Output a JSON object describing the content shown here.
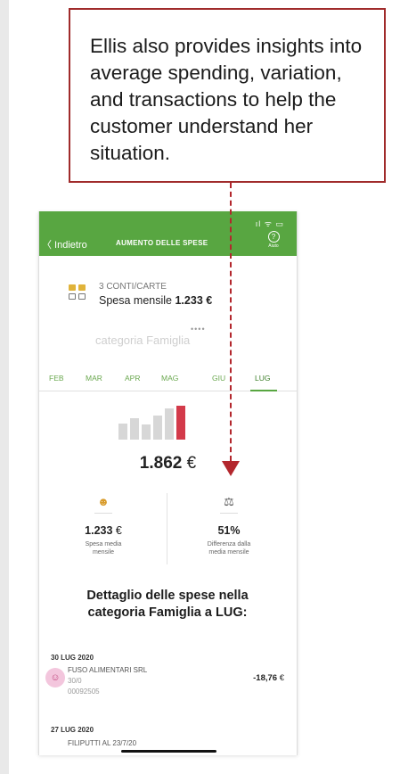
{
  "callout": {
    "text": "Ellis also provides insights into average spending, variation, and transactions to help the customer understand her situation."
  },
  "status_bar": {
    "icons": "ıl ᯤ ▭"
  },
  "header": {
    "back_label": "〈 Indietro",
    "title": "AUMENTO DELLE SPESE",
    "help_icon": "?",
    "help_label": "Aiuto",
    "color": "#58a641"
  },
  "account": {
    "cards_count": "3 CONTI/CARTE",
    "spend_label": "Spesa mensile",
    "spend_value": "1.233 €",
    "dots": "••••",
    "faded_text": "categoria Famiglia"
  },
  "tabs": {
    "items": [
      "FEB",
      "MAR",
      "APR",
      "MAG",
      "GIU",
      "LUG"
    ],
    "active": "LUG"
  },
  "chart_data": {
    "type": "bar",
    "categories": [
      "FEB",
      "MAR",
      "APR",
      "MAG",
      "GIU",
      "LUG"
    ],
    "values": [
      900,
      1180,
      850,
      1330,
      1720,
      1862
    ],
    "ylim": [
      0,
      1862
    ],
    "colors": {
      "default": "#d7d7d7",
      "highlight": "#d33a4a"
    }
  },
  "total": {
    "amount": "1.862",
    "currency": "€"
  },
  "stats": [
    {
      "icon": "☻",
      "value": "1.233",
      "currency": "€",
      "label_line1": "Spesa media",
      "label_line2": "mensile"
    },
    {
      "icon": "⚖",
      "value": "51%",
      "currency": "",
      "label_line1": "Differenza dalla",
      "label_line2": "media mensile"
    }
  ],
  "detail_title": "Dettaglio delle spese nella categoria Famiglia a LUG:",
  "transactions": [
    {
      "date": "30 LUG 2020",
      "avatar_icon": "☺",
      "merchant": "FUSO ALIMENTARI SRL",
      "sub1": "30/0",
      "sub2": "00092505",
      "amount": "-18,76",
      "currency": "€"
    },
    {
      "date": "27 LUG 2020",
      "merchant": "FILIPUTTI AL 23/7/20"
    }
  ],
  "annotation_color": "#b3272d"
}
